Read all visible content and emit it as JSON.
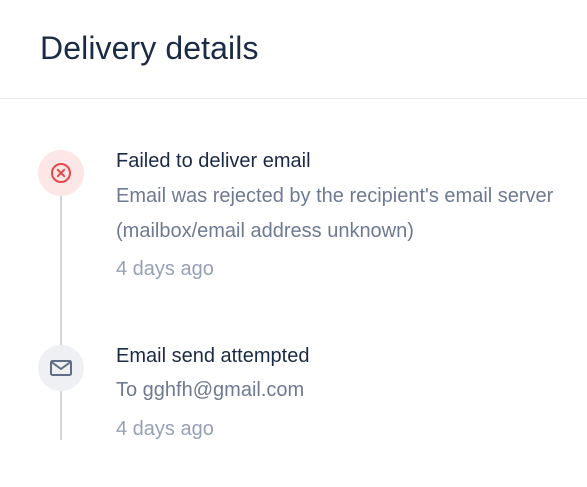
{
  "header": {
    "title": "Delivery details"
  },
  "events": [
    {
      "status": "failed",
      "icon": "error-circle-x-icon",
      "title": "Failed to deliver email",
      "description": "Email was rejected by the recipient's email server (mailbox/email address unknown)",
      "time": "4 days ago"
    },
    {
      "status": "attempted",
      "icon": "envelope-icon",
      "title": "Email send attempted",
      "description": "To gghfh@gmail.com",
      "time": "4 days ago"
    }
  ],
  "colors": {
    "title_text": "#1b2a45",
    "description_text": "#6e7a92",
    "time_text": "#95a1b6",
    "failed_icon_bg": "#fde6e6",
    "failed_icon_fg": "#e5484d",
    "neutral_icon_bg": "#eef0f4",
    "neutral_icon_fg": "#5f6d86",
    "timeline_line": "#cfd5e0"
  }
}
